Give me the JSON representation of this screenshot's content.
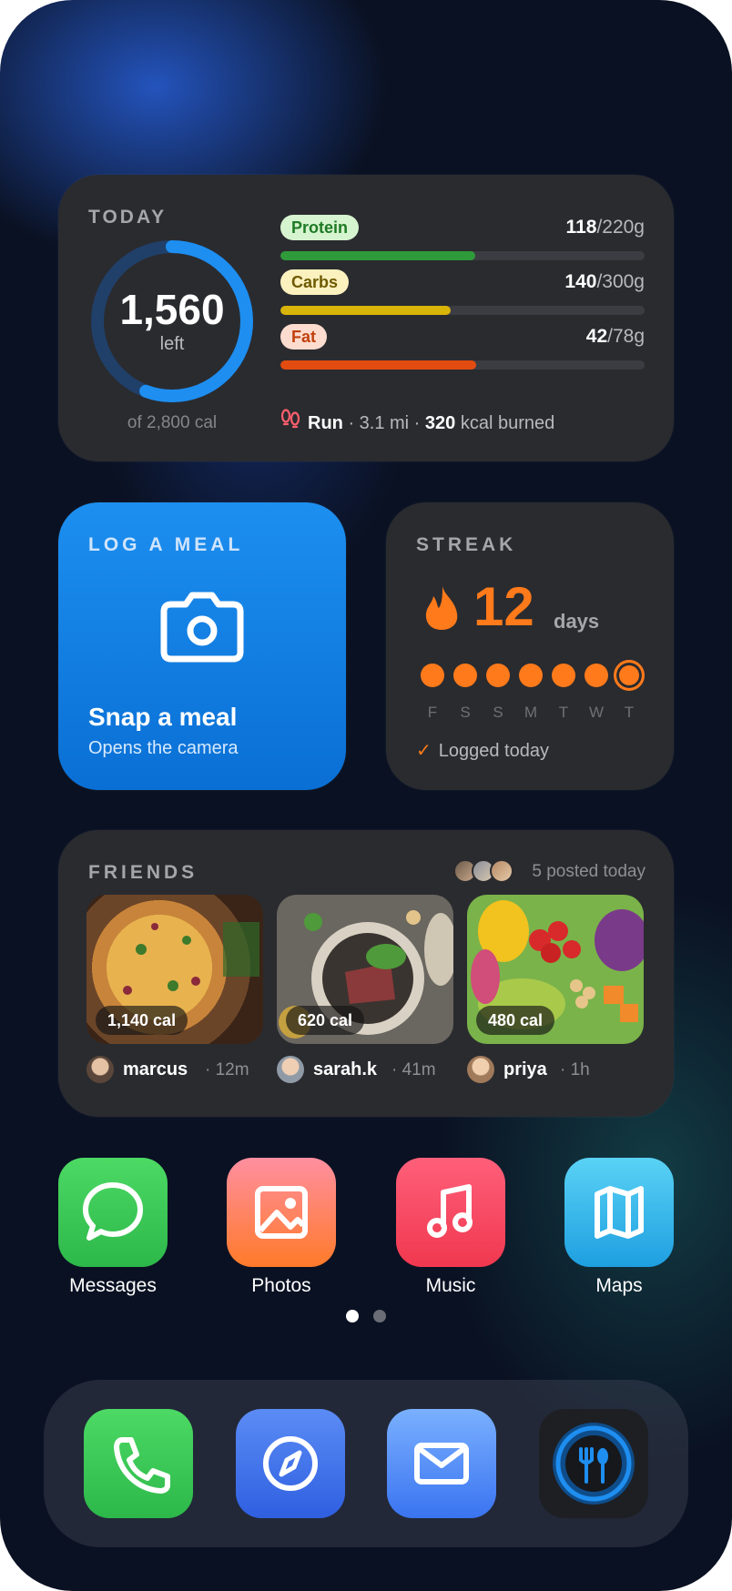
{
  "today": {
    "label": "TODAY",
    "calories_left": "1,560",
    "left_label": "left",
    "of_total": "of 2,800 cal",
    "ring_fraction": 0.557,
    "macros": [
      {
        "name": "Protein",
        "eaten": "118",
        "target": "/220g",
        "fraction": 0.536,
        "color": "#2f9a3a",
        "pill_bg": "#d6f4cf",
        "pill_fg": "#1e7a25"
      },
      {
        "name": "Carbs",
        "eaten": "140",
        "target": "/300g",
        "fraction": 0.467,
        "color": "#d9b409",
        "pill_bg": "#fbf1bf",
        "pill_fg": "#6e5a00"
      },
      {
        "name": "Fat",
        "eaten": "42",
        "target": "/78g",
        "fraction": 0.538,
        "color": "#e24c10",
        "pill_bg": "#fcdccf",
        "pill_fg": "#c0410d"
      }
    ],
    "activity": {
      "icon": "footprints-icon",
      "name": "Run",
      "distance": " · 3.1 mi · ",
      "kcal": "320",
      "suffix": " kcal burned"
    }
  },
  "log_meal": {
    "label": "LOG A MEAL",
    "icon": "camera-icon",
    "title": "Snap a meal",
    "subtitle": "Opens the camera"
  },
  "streak": {
    "label": "STREAK",
    "icon": "flame-icon",
    "count": "12",
    "unit": "days",
    "days": [
      "F",
      "S",
      "S",
      "M",
      "T",
      "W",
      "T"
    ],
    "status": "Logged today",
    "accent": "#ff7a1a"
  },
  "friends": {
    "label": "FRIENDS",
    "posted": "5 posted today",
    "posts": [
      {
        "user": "marcus",
        "time": "· 12m",
        "calories": "1,140 cal"
      },
      {
        "user": "sarah.k",
        "time": "· 41m",
        "calories": "620 cal"
      },
      {
        "user": "priya",
        "time": "· 1h",
        "calories": "480 cal"
      }
    ]
  },
  "apps": [
    {
      "label": "Messages",
      "icon": "message-bubble-icon"
    },
    {
      "label": "Photos",
      "icon": "photo-icon"
    },
    {
      "label": "Music",
      "icon": "music-note-icon"
    },
    {
      "label": "Maps",
      "icon": "map-icon"
    }
  ],
  "page_dots": {
    "count": 2,
    "active": 1
  },
  "dock": [
    {
      "name": "Phone",
      "icon": "phone-icon"
    },
    {
      "name": "Safari",
      "icon": "compass-icon"
    },
    {
      "name": "Mail",
      "icon": "mail-icon"
    },
    {
      "name": "Food tracker",
      "icon": "fork-spoon-icon"
    }
  ]
}
